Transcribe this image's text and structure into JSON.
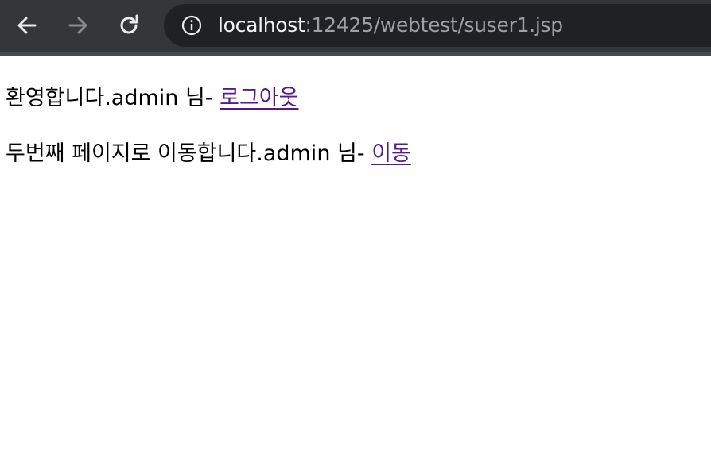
{
  "browser": {
    "url_host": "localhost",
    "url_path": ":12425/webtest/suser1.jsp",
    "icons": {
      "back": "back-arrow-icon",
      "forward": "forward-arrow-icon",
      "reload": "reload-icon",
      "info": "info-icon"
    },
    "colors": {
      "toolbar": "#35363a",
      "omnibox": "#202124",
      "host_text": "#f1f3f4",
      "path_text": "#9aa0a6"
    }
  },
  "page": {
    "line1_text": "환영합니다.admin 님- ",
    "logout_link": "로그아웃",
    "line2_text": "두번째 페이지로 이동합니다.admin 님- ",
    "move_link": "이동",
    "colors": {
      "text": "#000000",
      "visited_link": "#551a8b"
    }
  }
}
